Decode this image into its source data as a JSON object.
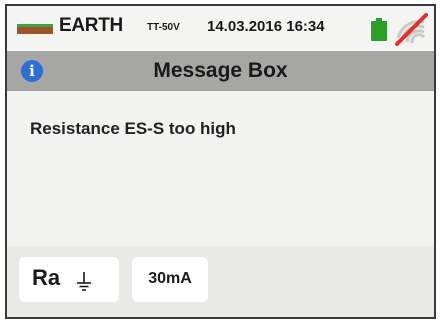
{
  "status_bar": {
    "mode": "EARTH",
    "mode_sub": "TT-50V",
    "datetime": "14.03.2016 16:34",
    "battery_icon": "battery-full-icon",
    "wireless_icon": "wifi-off-icon",
    "colors": {
      "battery": "#2aa02a",
      "wifi_slash": "#e23030",
      "wifi_arcs": "#c9c9c9"
    }
  },
  "title_bar": {
    "icon": "info-icon",
    "icon_glyph": "i",
    "title": "Message Box",
    "colors": {
      "background": "#a6a7a4",
      "info_icon": "#2e6fd6"
    }
  },
  "message": {
    "text": "Resistance ES-S too high"
  },
  "softkeys": [
    {
      "label": "Ra",
      "icon": "ground-icon"
    },
    {
      "label": "30mA"
    }
  ]
}
